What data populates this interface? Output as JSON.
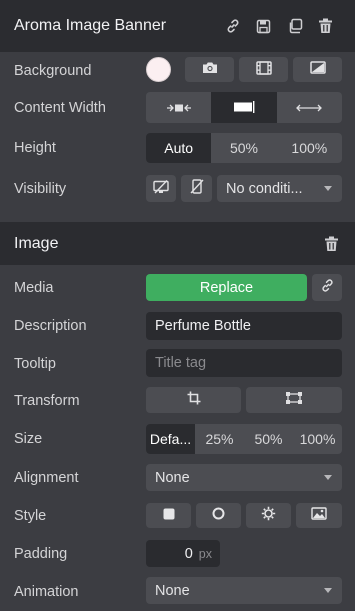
{
  "panel1": {
    "title": "Aroma Image Banner",
    "icons": [
      "link-icon",
      "save-icon",
      "copy-icon",
      "trash-icon"
    ],
    "rows": {
      "background": {
        "label": "Background",
        "swatch_color": "#fbeff1"
      },
      "content_width": {
        "label": "Content Width"
      },
      "height": {
        "label": "Height",
        "options": [
          "Auto",
          "50%",
          "100%"
        ],
        "selected": "Auto"
      },
      "visibility": {
        "label": "Visibility",
        "select_value": "No conditi..."
      }
    }
  },
  "panel2": {
    "title": "Image",
    "rows": {
      "media": {
        "label": "Media",
        "button": "Replace"
      },
      "description": {
        "label": "Description",
        "value": "Perfume Bottle"
      },
      "tooltip": {
        "label": "Tooltip",
        "placeholder": "Title tag"
      },
      "transform": {
        "label": "Transform"
      },
      "size": {
        "label": "Size",
        "options": [
          "Defa...",
          "25%",
          "50%",
          "100%"
        ],
        "selected": "Defa..."
      },
      "alignment": {
        "label": "Alignment",
        "value": "None"
      },
      "style": {
        "label": "Style"
      },
      "padding": {
        "label": "Padding",
        "value": "0",
        "unit": "px"
      },
      "animation": {
        "label": "Animation",
        "value": "None"
      }
    }
  },
  "colors": {
    "header_bg": "#2b2c30",
    "panel_bg": "#3c3d42",
    "control_bg": "#4c4d52",
    "field_bg": "#2a2b2f",
    "accent_green": "#3fae60"
  }
}
